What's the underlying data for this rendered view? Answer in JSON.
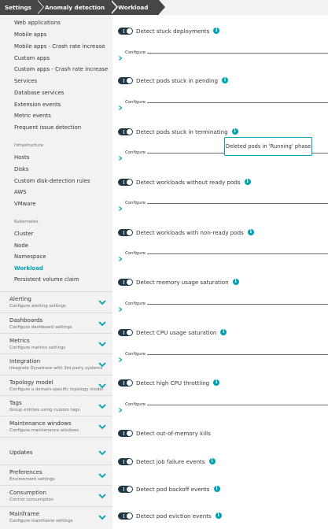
{
  "breadcrumb": [
    "Settings",
    "Anomaly detection",
    "Workload"
  ],
  "colors": {
    "accent": "#00a1b2",
    "breadcrumb_bg": "#454646",
    "toggle_on": "#1e3945",
    "sidebar_bg": "#f2f2f2"
  },
  "sidebar": {
    "anomaly_items": [
      {
        "label": "Web applications"
      },
      {
        "label": "Mobile apps"
      },
      {
        "label": "Mobile apps - Crash rate increase"
      },
      {
        "label": "Custom apps"
      },
      {
        "label": "Custom apps - Crash rate increase"
      },
      {
        "label": "Services"
      },
      {
        "label": "Database services"
      },
      {
        "label": "Extension events"
      },
      {
        "label": "Metric events"
      },
      {
        "label": "Frequent issue detection"
      }
    ],
    "infrastructure_group": "Infrastructure",
    "infrastructure_items": [
      {
        "label": "Hosts"
      },
      {
        "label": "Disks"
      },
      {
        "label": "Custom disk-detection rules"
      },
      {
        "label": "AWS"
      },
      {
        "label": "VMware"
      }
    ],
    "kubernetes_group": "Kubernetes",
    "kubernetes_items": [
      {
        "label": "Cluster"
      },
      {
        "label": "Node"
      },
      {
        "label": "Namespace"
      },
      {
        "label": "Workload",
        "active": true
      },
      {
        "label": "Persistent volume claim"
      }
    ],
    "sections": [
      {
        "title": "Alerting",
        "description": "Configure alerting settings"
      },
      {
        "title": "Dashboards",
        "description": "Configure dashboard settings"
      },
      {
        "title": "Metrics",
        "description": "Configure metrics settings"
      },
      {
        "title": "Integration",
        "description": "Integrate Dynatrace with 3rd party systems"
      },
      {
        "title": "Topology model",
        "description": "Configure a domain-specific topology model"
      },
      {
        "title": "Tags",
        "description": "Group entities using custom tags"
      },
      {
        "title": "Maintenance windows",
        "description": "Configure maintenance windows"
      },
      {
        "title": "Updates",
        "description": ""
      },
      {
        "title": "Preferences",
        "description": "Environment settings"
      },
      {
        "title": "Consumption",
        "description": "Control consumption"
      },
      {
        "title": "Mainframe",
        "description": "Configure mainframe settings"
      }
    ]
  },
  "main": {
    "configure_label": "Configure",
    "info_glyph": "i",
    "tooltip": "Deleted pods in 'Running' phase",
    "detections": [
      {
        "label": "Detect stuck deployments",
        "enabled": true,
        "info_icon": true,
        "configurable": true
      },
      {
        "label": "Detect pods stuck in pending",
        "enabled": true,
        "info_icon": true,
        "configurable": true
      },
      {
        "label": "Detect pods stuck in terminating",
        "enabled": true,
        "info_icon": true,
        "configurable": true
      },
      {
        "label": "Detect workloads without ready pods",
        "enabled": true,
        "info_icon": true,
        "configurable": true
      },
      {
        "label": "Detect workloads with non-ready pods",
        "enabled": true,
        "info_icon": true,
        "configurable": true
      },
      {
        "label": "Detect memory usage saturation",
        "enabled": true,
        "info_icon": true,
        "configurable": true
      },
      {
        "label": "Detect CPU usage saturation",
        "enabled": true,
        "info_icon": true,
        "configurable": true
      },
      {
        "label": "Detect high CPU throttling",
        "enabled": true,
        "info_icon": true,
        "configurable": true
      },
      {
        "label": "Detect out-of-memory kills",
        "enabled": true,
        "info_icon": false,
        "configurable": false
      },
      {
        "label": "Detect job failure events",
        "enabled": true,
        "info_icon": true,
        "configurable": false
      },
      {
        "label": "Detect pod backoff events",
        "enabled": true,
        "info_icon": true,
        "configurable": false
      },
      {
        "label": "Detect pod eviction events",
        "enabled": true,
        "info_icon": true,
        "configurable": false
      }
    ]
  }
}
